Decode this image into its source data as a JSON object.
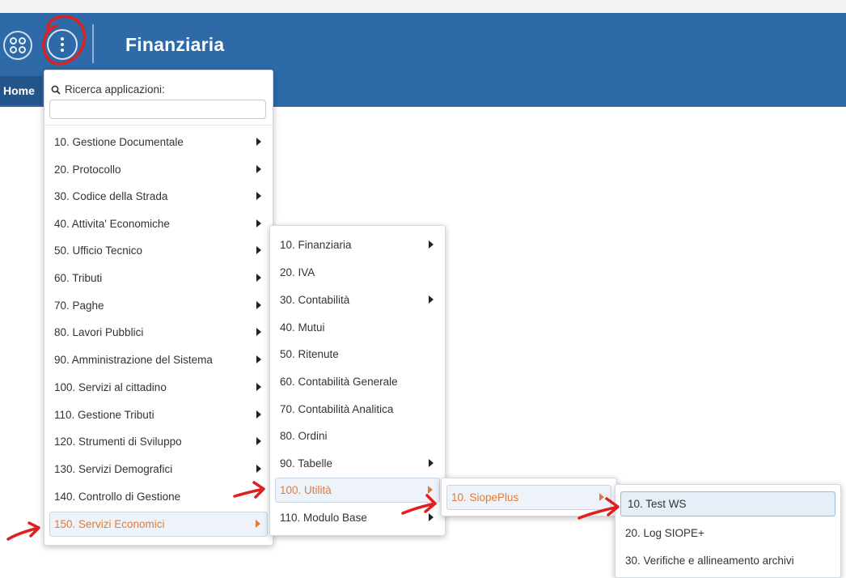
{
  "header": {
    "app_title": "Finanziaria",
    "nav_home": "Home"
  },
  "icons": {
    "apps": "apps-grid-icon",
    "more": "kebab-menu-icon",
    "search": "search-icon",
    "submenu": "chevron-right-icon"
  },
  "menu1": {
    "search_label": "Ricerca applicazioni:",
    "search_value": "",
    "items": [
      {
        "label": "10. Gestione Documentale"
      },
      {
        "label": "20. Protocollo"
      },
      {
        "label": "30. Codice della Strada"
      },
      {
        "label": "40. Attivita' Economiche"
      },
      {
        "label": "50. Ufficio Tecnico"
      },
      {
        "label": "60. Tributi"
      },
      {
        "label": "70. Paghe"
      },
      {
        "label": "80. Lavori Pubblici"
      },
      {
        "label": "90. Amministrazione del Sistema"
      },
      {
        "label": "100. Servizi al cittadino"
      },
      {
        "label": "110. Gestione Tributi"
      },
      {
        "label": "120. Strumenti di Sviluppo"
      },
      {
        "label": "130. Servizi Demografici"
      },
      {
        "label": "140. Controllo di Gestione"
      },
      {
        "label": "150. Servizi Economici"
      }
    ]
  },
  "menu2": {
    "items": [
      {
        "label": "10. Finanziaria"
      },
      {
        "label": "20. IVA"
      },
      {
        "label": "30. Contabilità"
      },
      {
        "label": "40. Mutui"
      },
      {
        "label": "50. Ritenute"
      },
      {
        "label": "60. Contabilità Generale"
      },
      {
        "label": "70. Contabilità Analitica"
      },
      {
        "label": "80. Ordini"
      },
      {
        "label": "90. Tabelle"
      },
      {
        "label": "100. Utilità"
      },
      {
        "label": "110. Modulo Base"
      }
    ]
  },
  "menu3": {
    "items": [
      {
        "label": "10. SiopePlus"
      }
    ]
  },
  "menu4": {
    "items": [
      {
        "label": "10. Test WS"
      },
      {
        "label": "20. Log SIOPE+"
      },
      {
        "label": "30. Verifiche e allineamento archivi"
      }
    ]
  },
  "colors": {
    "header_blue": "#2e6aa8",
    "active_orange": "#e07b39",
    "annotation_red": "#e02020"
  }
}
